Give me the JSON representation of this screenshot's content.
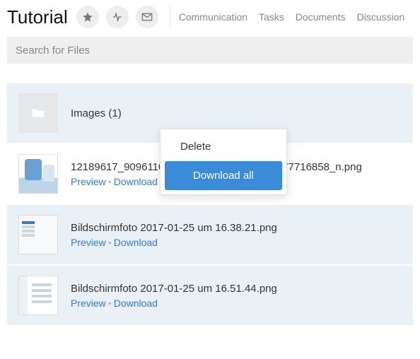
{
  "header": {
    "title": "Tutorial",
    "tabs": [
      "Communication",
      "Tasks",
      "Documents",
      "Discussion"
    ]
  },
  "search": {
    "placeholder": "Search for Files"
  },
  "folder": {
    "label": "Images (1)"
  },
  "files": [
    {
      "name": "12189617_909611099103286_6085235246277716858_n.png",
      "preview": "Preview",
      "download": "Download"
    },
    {
      "name": "Bildschirmfoto 2017-01-25 um 16.38.21.png",
      "preview": "Preview",
      "download": "Download"
    },
    {
      "name": "Bildschirmfoto 2017-01-25 um 16.51.44.png",
      "preview": "Preview",
      "download": "Download"
    }
  ],
  "menu": {
    "delete": "Delete",
    "download_all": "Download all"
  }
}
